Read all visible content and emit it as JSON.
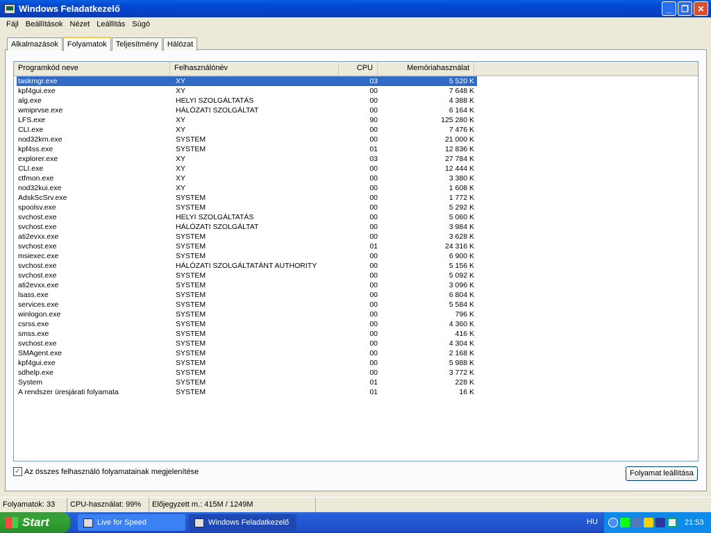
{
  "window": {
    "title": "Windows Feladatkezelő"
  },
  "menu": [
    "Fájl",
    "Beállítások",
    "Nézet",
    "Leállítás",
    "Súgó"
  ],
  "tabs": [
    {
      "label": "Alkalmazások"
    },
    {
      "label": "Folyamatok",
      "active": true
    },
    {
      "label": "Teljesítmény"
    },
    {
      "label": "Hálózat"
    }
  ],
  "columns": [
    "Programkód neve",
    "Felhasználónév",
    "CPU",
    "Memóriahasználat"
  ],
  "processes": [
    [
      "taskmgr.exe",
      "XY",
      "03",
      "5 520 K"
    ],
    [
      "kpf4gui.exe",
      "XY",
      "00",
      "7 648 K"
    ],
    [
      "alg.exe",
      "HELYI SZOLGÁLTATÁS",
      "00",
      "4 388 K"
    ],
    [
      "wmiprvse.exe",
      "HÁLÓZATI SZOLGÁLTAT",
      "00",
      "6 164 K"
    ],
    [
      "LFS.exe",
      "XY",
      "90",
      "125 280 K"
    ],
    [
      "CLI.exe",
      "XY",
      "00",
      "7 476 K"
    ],
    [
      "nod32krn.exe",
      "SYSTEM",
      "00",
      "21 000 K"
    ],
    [
      "kpf4ss.exe",
      "SYSTEM",
      "01",
      "12 836 K"
    ],
    [
      "explorer.exe",
      "XY",
      "03",
      "27 784 K"
    ],
    [
      "CLI.exe",
      "XY",
      "00",
      "12 444 K"
    ],
    [
      "ctfmon.exe",
      "XY",
      "00",
      "3 380 K"
    ],
    [
      "nod32kui.exe",
      "XY",
      "00",
      "1 608 K"
    ],
    [
      "AdskScSrv.exe",
      "SYSTEM",
      "00",
      "1 772 K"
    ],
    [
      "spoolsv.exe",
      "SYSTEM",
      "00",
      "5 292 K"
    ],
    [
      "svchost.exe",
      "HELYI SZOLGÁLTATÁS",
      "00",
      "5 060 K"
    ],
    [
      "svchost.exe",
      "HÁLÓZATI SZOLGÁLTAT",
      "00",
      "3 984 K"
    ],
    [
      "ati2evxx.exe",
      "SYSTEM",
      "00",
      "3 628 K"
    ],
    [
      "svchost.exe",
      "SYSTEM",
      "01",
      "24 316 K"
    ],
    [
      "msiexec.exe",
      "SYSTEM",
      "00",
      "6 900 K"
    ],
    [
      "svchost.exe",
      "HÁLÓZATI SZOLGÁLTATÁNT AUTHORITY",
      "00",
      "5 156 K"
    ],
    [
      "svchost.exe",
      "SYSTEM",
      "00",
      "5 092 K"
    ],
    [
      "ati2evxx.exe",
      "SYSTEM",
      "00",
      "3 096 K"
    ],
    [
      "lsass.exe",
      "SYSTEM",
      "00",
      "6 804 K"
    ],
    [
      "services.exe",
      "SYSTEM",
      "00",
      "5 584 K"
    ],
    [
      "winlogon.exe",
      "SYSTEM",
      "00",
      "796 K"
    ],
    [
      "csrss.exe",
      "SYSTEM",
      "00",
      "4 360 K"
    ],
    [
      "smss.exe",
      "SYSTEM",
      "00",
      "416 K"
    ],
    [
      "svchost.exe",
      "SYSTEM",
      "00",
      "4 304 K"
    ],
    [
      "SMAgent.exe",
      "SYSTEM",
      "00",
      "2 168 K"
    ],
    [
      "kpf4gui.exe",
      "SYSTEM",
      "00",
      "5 988 K"
    ],
    [
      "sdhelp.exe",
      "SYSTEM",
      "00",
      "3 772 K"
    ],
    [
      "System",
      "SYSTEM",
      "01",
      "228 K"
    ],
    [
      "A rendszer üresjárati folyamata",
      "SYSTEM",
      "01",
      "16 K"
    ]
  ],
  "selected_index": 0,
  "show_all_users": {
    "label": "Az összes felhasználó folyamatainak megjelenítése",
    "checked": true
  },
  "end_process_label": "Folyamat leállítása",
  "status": {
    "processes": "Folyamatok: 33",
    "cpu": "CPU-használat: 99%",
    "commit": "Előjegyzett m.: 415M / 1249M"
  },
  "taskbar": {
    "start": "Start",
    "tasks": [
      "Live for Speed",
      "Windows Feladatkezelő"
    ],
    "lang": "HU",
    "clock": "21:53"
  }
}
